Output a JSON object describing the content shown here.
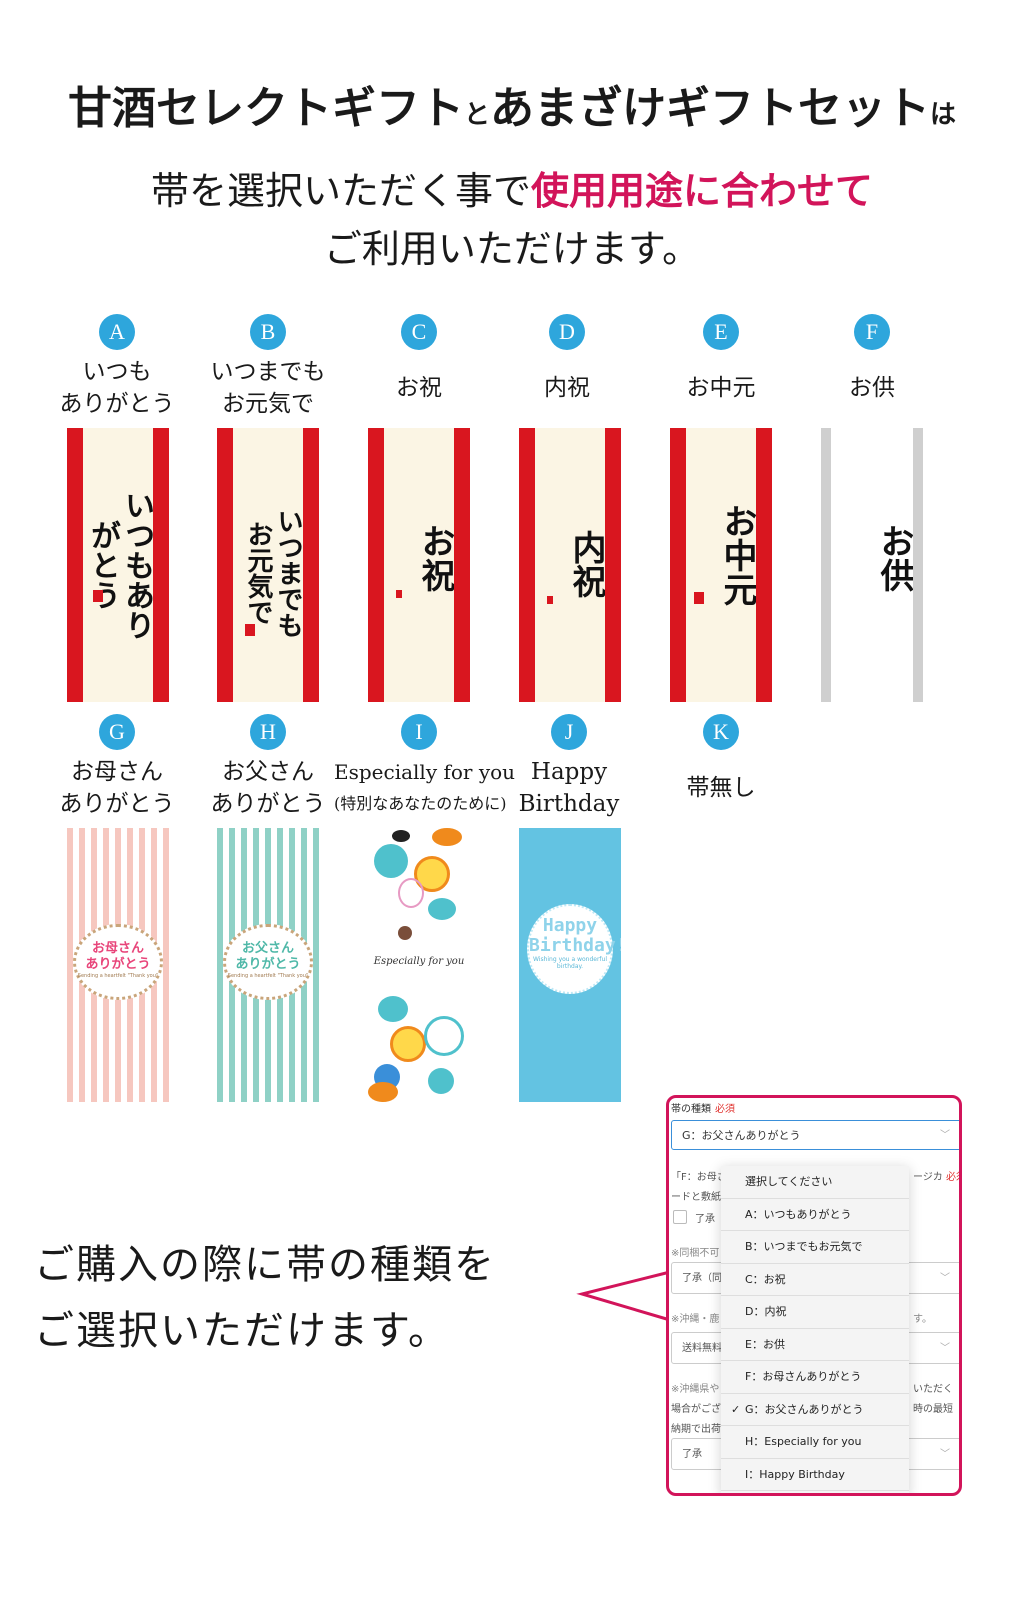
{
  "header": {
    "title_part1": "甘酒セレクトギフト",
    "title_join": "と",
    "title_part2": "あまざけギフトセット",
    "title_tail": "は",
    "subtitle_prefix": "帯を選択いただく事で",
    "subtitle_accent": "使用用途に合わせて",
    "subtitle_line2": "ご利用いただけます。",
    "accent_color": "#d2145a",
    "badge_color": "#2ea6dc"
  },
  "bands": [
    {
      "letter": "A",
      "label_lines": [
        "いつも",
        "ありがとう"
      ],
      "art_text": "いつもありがとう",
      "style": "red"
    },
    {
      "letter": "B",
      "label_lines": [
        "いつまでも",
        "お元気で"
      ],
      "art_text": "いつまでもお元気で",
      "style": "red"
    },
    {
      "letter": "C",
      "label_lines": [
        "お祝"
      ],
      "art_text": "お祝",
      "style": "red"
    },
    {
      "letter": "D",
      "label_lines": [
        "内祝"
      ],
      "art_text": "内祝",
      "style": "red"
    },
    {
      "letter": "E",
      "label_lines": [
        "お中元"
      ],
      "art_text": "お中元",
      "style": "red"
    },
    {
      "letter": "F",
      "label_lines": [
        "お供"
      ],
      "art_text": "お供",
      "style": "grey"
    },
    {
      "letter": "G",
      "label_lines": [
        "お母さん",
        "ありがとう"
      ],
      "art_text_1": "お母さん",
      "art_text_2": "ありがとう",
      "art_small": "Sending a heartfelt \"Thank you\"",
      "style": "pink-stripe"
    },
    {
      "letter": "H",
      "label_lines": [
        "お父さん",
        "ありがとう"
      ],
      "art_text_1": "お父さん",
      "art_text_2": "ありがとう",
      "art_small": "Sending a heartfelt \"Thank you\"",
      "style": "teal-stripe"
    },
    {
      "letter": "I",
      "label_lines": [
        "Especially for you",
        "(特別なあなたのために)"
      ],
      "art_text": "Especially for you",
      "style": "pattern"
    },
    {
      "letter": "J",
      "label_lines": [
        "Happy",
        "Birthday"
      ],
      "art_text_1": "Happy",
      "art_text_2": "Birthday!",
      "art_small": "Wishing you a wonderful birthday.",
      "style": "blue"
    },
    {
      "letter": "K",
      "label_lines": [
        "帯無し"
      ],
      "style": "none"
    }
  ],
  "cta": {
    "line1": "ご購入の際に帯の種類を",
    "line2": "ご選択いただけます。"
  },
  "form": {
    "field_label": "帯の種類",
    "required": "必須",
    "selected_value": "G：お父さんありがとう",
    "bg_lines": [
      "「F：お母さ",
      "ージカ",
      "必須",
      "ードと敷紙",
      "了承",
      "※同梱不可",
      "了承（同",
      "※沖縄・鹿",
      "す。",
      "送料無料",
      "※沖縄県や",
      "いただく",
      "場合がござ",
      "時の最短",
      "納期で出荷",
      "了承"
    ],
    "dropdown_options": [
      {
        "label": "選択してください",
        "checked": false
      },
      {
        "label": "A：いつもありがとう",
        "checked": false
      },
      {
        "label": "B：いつまでもお元気で",
        "checked": false
      },
      {
        "label": "C：お祝",
        "checked": false
      },
      {
        "label": "D：内祝",
        "checked": false
      },
      {
        "label": "E：お供",
        "checked": false
      },
      {
        "label": "F：お母さんありがとう",
        "checked": false
      },
      {
        "label": "G：お父さんありがとう",
        "checked": true
      },
      {
        "label": "H：Especially for you",
        "checked": false
      },
      {
        "label": "I：Happy Birthday",
        "checked": false
      }
    ],
    "check_glyph": "✓"
  }
}
